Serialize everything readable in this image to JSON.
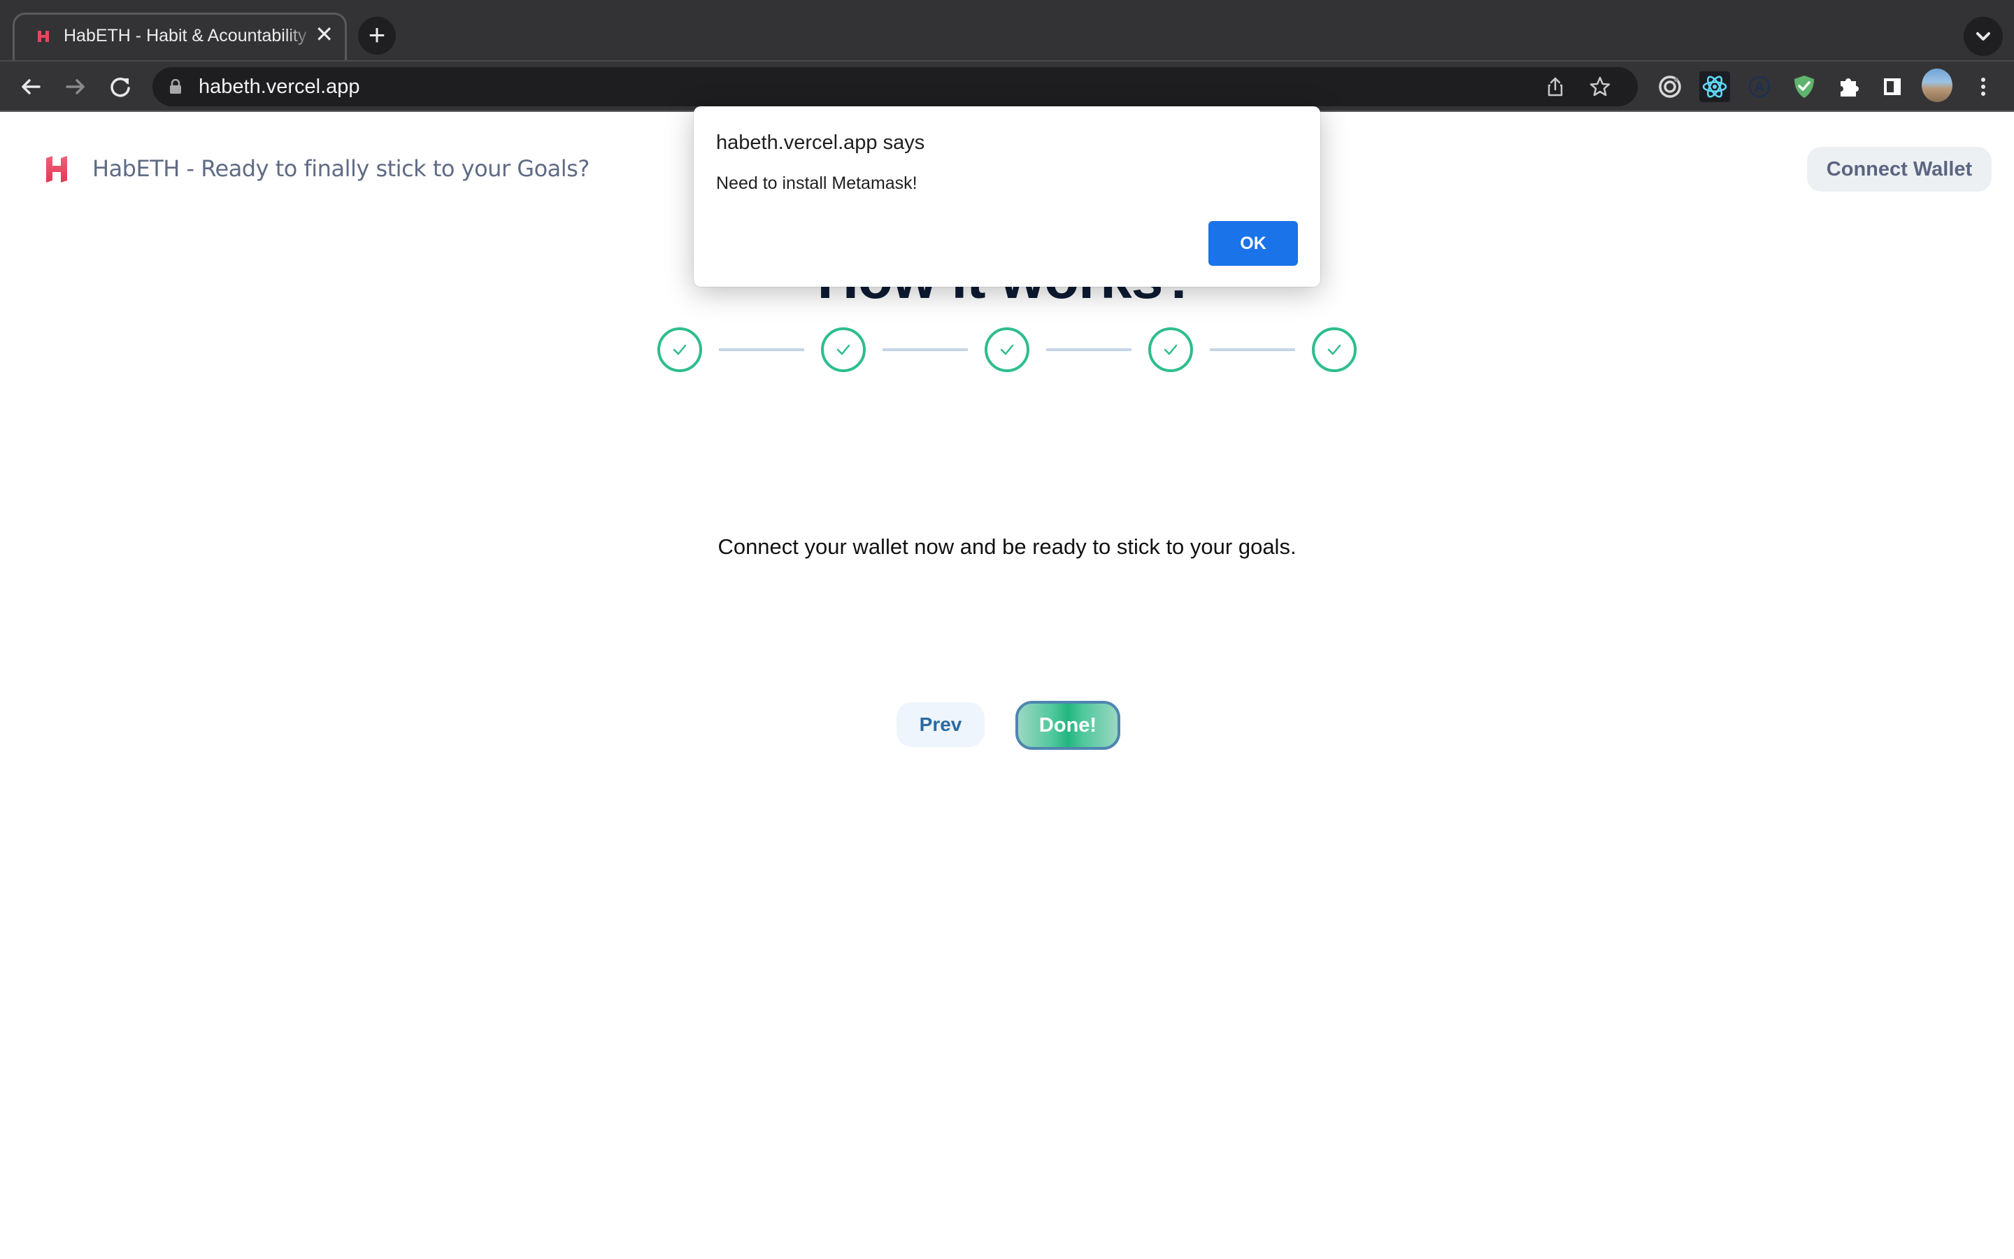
{
  "browser": {
    "tab": {
      "title": "HabETH - Habit & Acountability",
      "close_icon": "close-icon"
    },
    "new_tab_icon": "plus-icon",
    "url": "habeth.vercel.app",
    "extensions": [
      "target-extension",
      "react-devtools",
      "a-extension",
      "adguard-shield",
      "extensions-puzzle",
      "side-panel",
      "profile-avatar"
    ]
  },
  "header": {
    "brand_title": "HabETH - Ready to finally stick to your Goals?",
    "connect_wallet_label": "Connect Wallet"
  },
  "main": {
    "heading": "How it works?",
    "steps": [
      {
        "status": "complete"
      },
      {
        "status": "complete"
      },
      {
        "status": "complete"
      },
      {
        "status": "complete"
      },
      {
        "status": "complete"
      }
    ],
    "description": "Connect your wallet now and be ready to stick to your goals.",
    "prev_label": "Prev",
    "done_label": "Done!"
  },
  "dialog": {
    "title": "habeth.vercel.app says",
    "message": "Need to install Metamask!",
    "ok_label": "OK"
  },
  "colors": {
    "accent_green": "#2ebd8f",
    "brand_pink": "#e8455f",
    "dialog_button": "#1a73e8",
    "header_text": "#5f6b85"
  }
}
